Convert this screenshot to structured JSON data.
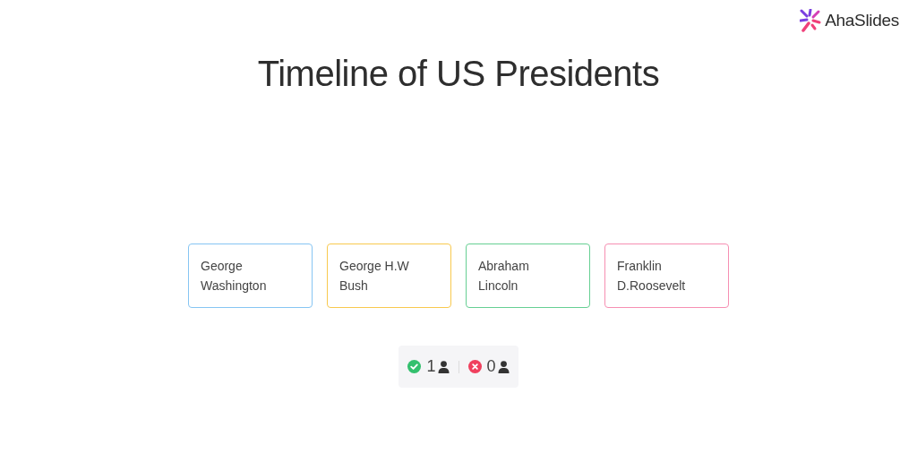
{
  "logo": {
    "text": "AhaSlides"
  },
  "title": "Timeline of US Presidents",
  "cards": [
    {
      "label": "George Washington",
      "color": "#86c5f3"
    },
    {
      "label": "George H.W Bush",
      "color": "#f8c94e"
    },
    {
      "label": "Abraham Lincoln",
      "color": "#66cf93"
    },
    {
      "label": "Franklin D.Roosevelt",
      "color": "#f68fb2"
    }
  ],
  "results": [
    {
      "kind": "correct",
      "count": "1"
    },
    {
      "kind": "incorrect",
      "count": "0"
    }
  ]
}
